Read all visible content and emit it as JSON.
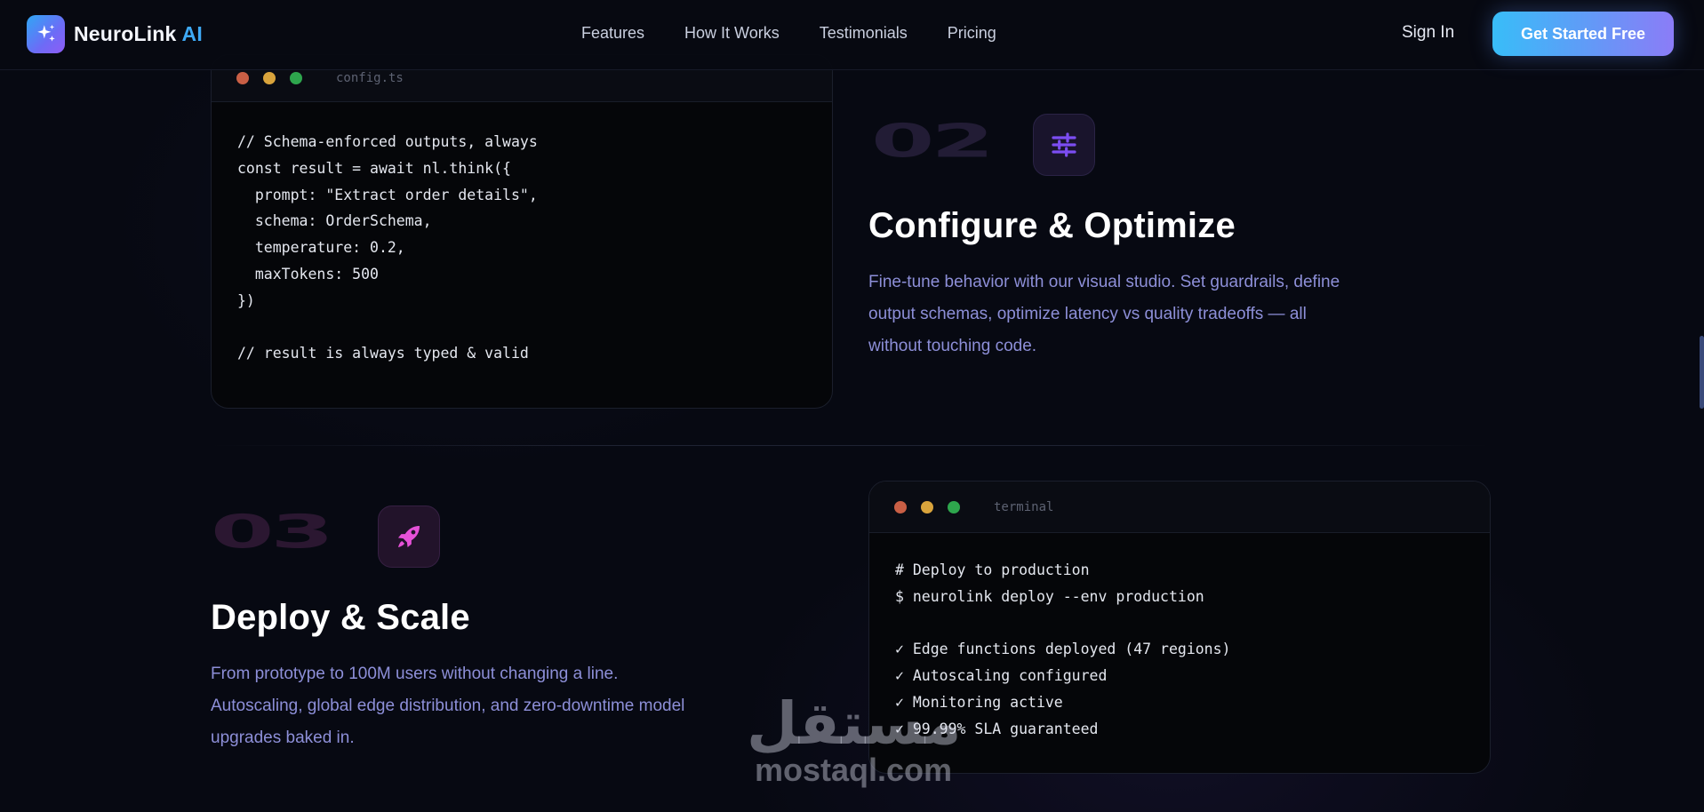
{
  "nav": {
    "brand": "NeuroLink",
    "brand_suffix": "AI",
    "logo_icon": "sparkles-icon",
    "links": [
      "Features",
      "How It Works",
      "Testimonials",
      "Pricing"
    ],
    "sign_in": "Sign In",
    "cta": "Get Started Free"
  },
  "steps": [
    {
      "number": "02",
      "icon": "sliders-icon",
      "title": "Configure & Optimize",
      "description": "Fine-tune behavior with our visual studio. Set guardrails, define output schemas, optimize latency vs quality tradeoffs — all without touching code.",
      "window_file": "config.ts",
      "code": "// Schema-enforced outputs, always\nconst result = await nl.think({\n  prompt: \"Extract order details\",\n  schema: OrderSchema,\n  temperature: 0.2,\n  maxTokens: 500\n})\n\n// result is always typed & valid"
    },
    {
      "number": "03",
      "icon": "rocket-icon",
      "title": "Deploy & Scale",
      "description": "From prototype to 100M users without changing a line. Autoscaling, global edge distribution, and zero-downtime model upgrades baked in.",
      "window_file": "terminal",
      "code": "# Deploy to production\n$ neurolink deploy --env production\n\n✓ Edge functions deployed (47 regions)\n✓ Autoscaling configured\n✓ Monitoring active\n✓ 99.99% SLA guaranteed"
    }
  ],
  "watermark": {
    "arabic": "مستقل",
    "latin": "mostaql.com"
  },
  "colors": {
    "background": "#070912",
    "accent_blue": "#3ea9f5",
    "accent_purple": "#8b7cf7",
    "desc_text": "#8d8fd8",
    "step2_icon": "#7c4df2",
    "step3_icon": "#e651d8"
  }
}
